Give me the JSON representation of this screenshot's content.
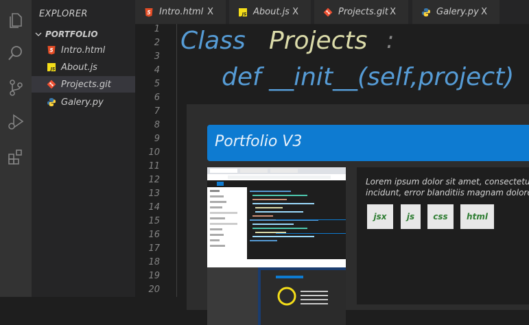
{
  "activity_bar": {
    "icons": [
      "files-icon",
      "search-icon",
      "source-control-icon",
      "run-debug-icon",
      "extensions-icon"
    ]
  },
  "sidebar": {
    "title": "EXPLORER",
    "folder": "PORTFOLIO",
    "files": [
      {
        "label": "Intro.html",
        "icon": "html-icon",
        "active": false
      },
      {
        "label": "About.js",
        "icon": "js-icon",
        "active": false
      },
      {
        "label": "Projects.git",
        "icon": "git-icon",
        "active": true
      },
      {
        "label": "Galery.py",
        "icon": "python-icon",
        "active": false
      }
    ]
  },
  "tabs": [
    {
      "label": "Intro.html",
      "icon": "html-icon",
      "close": "X"
    },
    {
      "label": "About.js",
      "icon": "js-icon",
      "close": "X"
    },
    {
      "label": "Projects.git",
      "icon": "git-icon",
      "close": "X"
    },
    {
      "label": "Galery.py",
      "icon": "python-icon",
      "close": "X"
    }
  ],
  "editor": {
    "line_numbers": [
      "1",
      "2",
      "3",
      "4",
      "5",
      "6",
      "7",
      "8",
      "9",
      "10",
      "11",
      "12",
      "13",
      "14",
      "15",
      "16",
      "17",
      "18",
      "19",
      "20"
    ],
    "code": {
      "keyword_class": "Class",
      "class_name": "Projects",
      "colon": ":",
      "def_line": "def __init__(self,project)"
    }
  },
  "project_card": {
    "title": "Portfolio V3",
    "description_line1": "Lorem ipsum dolor sit amet, consectetur a",
    "description_line2": "incidunt, error blanditiis magnam dolorem",
    "tags": [
      "jsx",
      "js",
      "css",
      "html"
    ]
  },
  "colors": {
    "activity_bar": "#333333",
    "sidebar": "#252526",
    "editor_bg": "#1e1e1e",
    "keyword_blue": "#569cd6",
    "class_yellow": "#dcdcaa",
    "banner_blue": "#0e7bd1",
    "tag_text_green": "#2e7d32"
  }
}
